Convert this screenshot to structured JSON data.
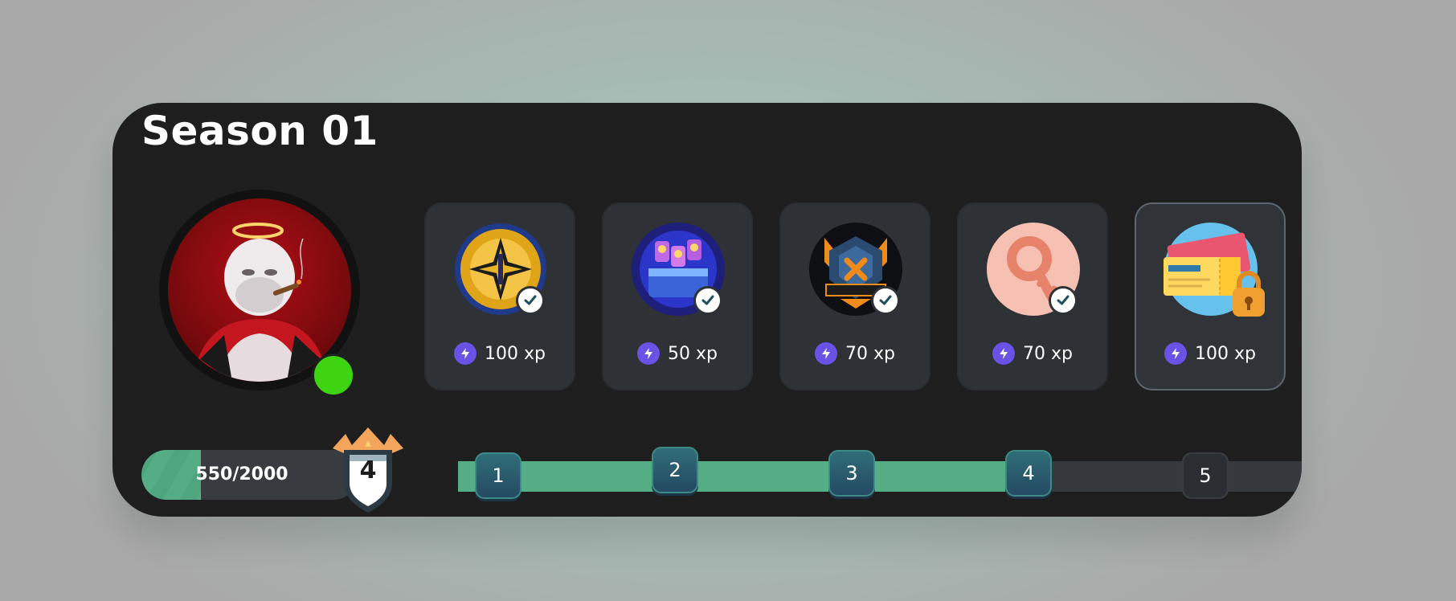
{
  "season": {
    "title": "Season 01"
  },
  "player": {
    "avatar_description": "white gorilla",
    "status": "online",
    "xp_progress": {
      "current": 550,
      "total": 2000,
      "label": "550/2000",
      "fraction": 0.275
    },
    "level_badge": "4"
  },
  "rewards": [
    {
      "name": "gold-emblem",
      "xp_label": "100 xp",
      "claimed": true
    },
    {
      "name": "loot-chest",
      "xp_label": "50 xp",
      "claimed": true
    },
    {
      "name": "esports-badge",
      "xp_label": "70 xp",
      "claimed": true
    },
    {
      "name": "key-token",
      "xp_label": "70 xp",
      "claimed": true
    },
    {
      "name": "locked-ticket",
      "xp_label": "100 xp",
      "claimed": false
    }
  ],
  "levels": [
    {
      "label": "1",
      "reached": true
    },
    {
      "label": "2",
      "reached": true
    },
    {
      "label": "3",
      "reached": true
    },
    {
      "label": "4",
      "reached": true
    },
    {
      "label": "5",
      "reached": false
    }
  ],
  "track_progress_levels": 4,
  "colors": {
    "card_bg": "#1e1e1e",
    "progress_green": "#55ad86",
    "online_green": "#3fd411",
    "xp_purple": "#6b52e6"
  }
}
